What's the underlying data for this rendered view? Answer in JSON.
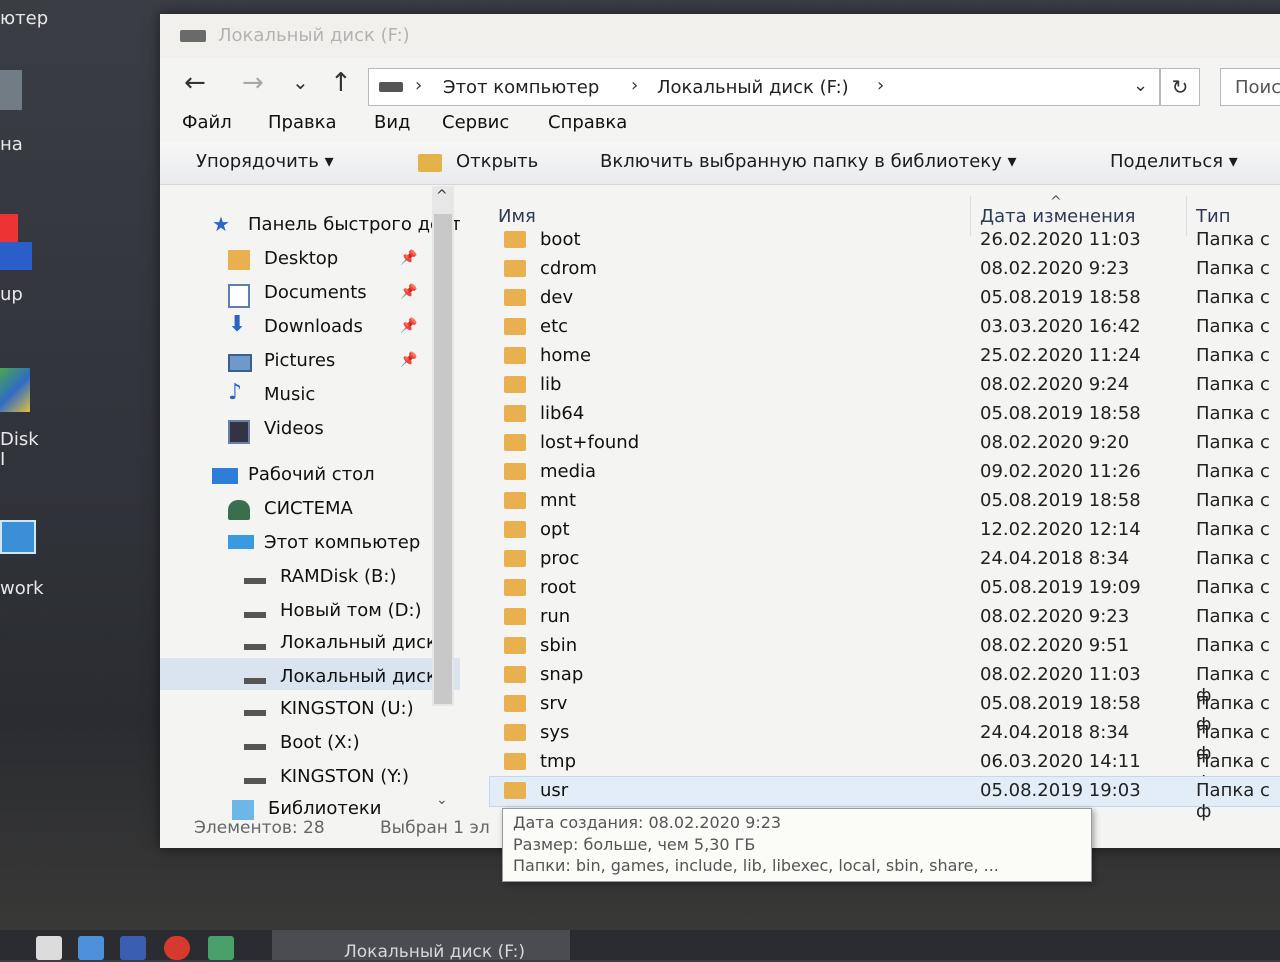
{
  "desktop": {
    "labels": [
      "ютер",
      "на",
      "up",
      "Disk",
      "I",
      "work"
    ]
  },
  "window": {
    "title": "Локальный диск (F:)"
  },
  "navbar": {
    "back": "←",
    "forward": "→",
    "recent": "⌄",
    "up": "↑",
    "breadcrumbs": [
      "Этот компьютер",
      "Локальный диск (F:)"
    ],
    "separator": "›",
    "dropdown": "⌄",
    "refresh": "↻",
    "search_placeholder": "Поис"
  },
  "menu": [
    "Файл",
    "Правка",
    "Вид",
    "Сервис",
    "Справка"
  ],
  "commands": {
    "organize": "Упорядочить ▾",
    "open": "Открыть",
    "include_library": "Включить выбранную папку в библиотеку ▾",
    "share": "Поделиться ▾"
  },
  "nav": {
    "quick_access": "Панель быстрого доступа",
    "quick_items": [
      "Desktop",
      "Documents",
      "Downloads",
      "Pictures",
      "Music",
      "Videos"
    ],
    "desktop_root": "Рабочий стол",
    "system": "СИСТЕМА",
    "this_pc": "Этот компьютер",
    "drives": [
      "RAMDisk (B:)",
      "Новый том (D:)",
      "Локальный диск",
      "Локальный диск",
      "KINGSTON (U:)",
      "Boot (X:)",
      "KINGSTON (Y:)"
    ],
    "libraries": "Библиотеки",
    "scroll_up": "^",
    "scroll_down": "⌄"
  },
  "columns": {
    "name": "Имя",
    "date": "Дата изменения",
    "type": "Тип",
    "sort_indicator": "^"
  },
  "files": [
    {
      "name": "boot",
      "date": "26.02.2020 11:03",
      "type": "Папка с"
    },
    {
      "name": "cdrom",
      "date": "08.02.2020 9:23",
      "type": "Папка с"
    },
    {
      "name": "dev",
      "date": "05.08.2019 18:58",
      "type": "Папка с"
    },
    {
      "name": "etc",
      "date": "03.03.2020 16:42",
      "type": "Папка с"
    },
    {
      "name": "home",
      "date": "25.02.2020 11:24",
      "type": "Папка с"
    },
    {
      "name": "lib",
      "date": "08.02.2020 9:24",
      "type": "Папка с"
    },
    {
      "name": "lib64",
      "date": "05.08.2019 18:58",
      "type": "Папка с"
    },
    {
      "name": "lost+found",
      "date": "08.02.2020 9:20",
      "type": "Папка с"
    },
    {
      "name": "media",
      "date": "09.02.2020 11:26",
      "type": "Папка с"
    },
    {
      "name": "mnt",
      "date": "05.08.2019 18:58",
      "type": "Папка с"
    },
    {
      "name": "opt",
      "date": "12.02.2020 12:14",
      "type": "Папка с"
    },
    {
      "name": "proc",
      "date": "24.04.2018 8:34",
      "type": "Папка с"
    },
    {
      "name": "root",
      "date": "05.08.2019 19:09",
      "type": "Папка с"
    },
    {
      "name": "run",
      "date": "08.02.2020 9:23",
      "type": "Папка с"
    },
    {
      "name": "sbin",
      "date": "08.02.2020 9:51",
      "type": "Папка с"
    },
    {
      "name": "snap",
      "date": "08.02.2020 11:03",
      "type": "Папка с ф"
    },
    {
      "name": "srv",
      "date": "05.08.2019 18:58",
      "type": "Папка с ф"
    },
    {
      "name": "sys",
      "date": "24.04.2018 8:34",
      "type": "Папка с ф"
    },
    {
      "name": "tmp",
      "date": "06.03.2020 14:11",
      "type": "Папка с ф"
    },
    {
      "name": "usr",
      "date": "05.08.2019 19:03",
      "type": "Папка с ф"
    }
  ],
  "status": {
    "count": "Элементов: 28",
    "selected": "Выбран 1 эл"
  },
  "tooltip": {
    "created": "Дата создания: 08.02.2020 9:23",
    "size": "Размер: больше, чем 5,30 ГБ",
    "folders": "Папки: bin, games, include, lib, libexec, local, sbin, share, ..."
  },
  "taskbar": {
    "active_window": "Локальный диск (F:)"
  }
}
